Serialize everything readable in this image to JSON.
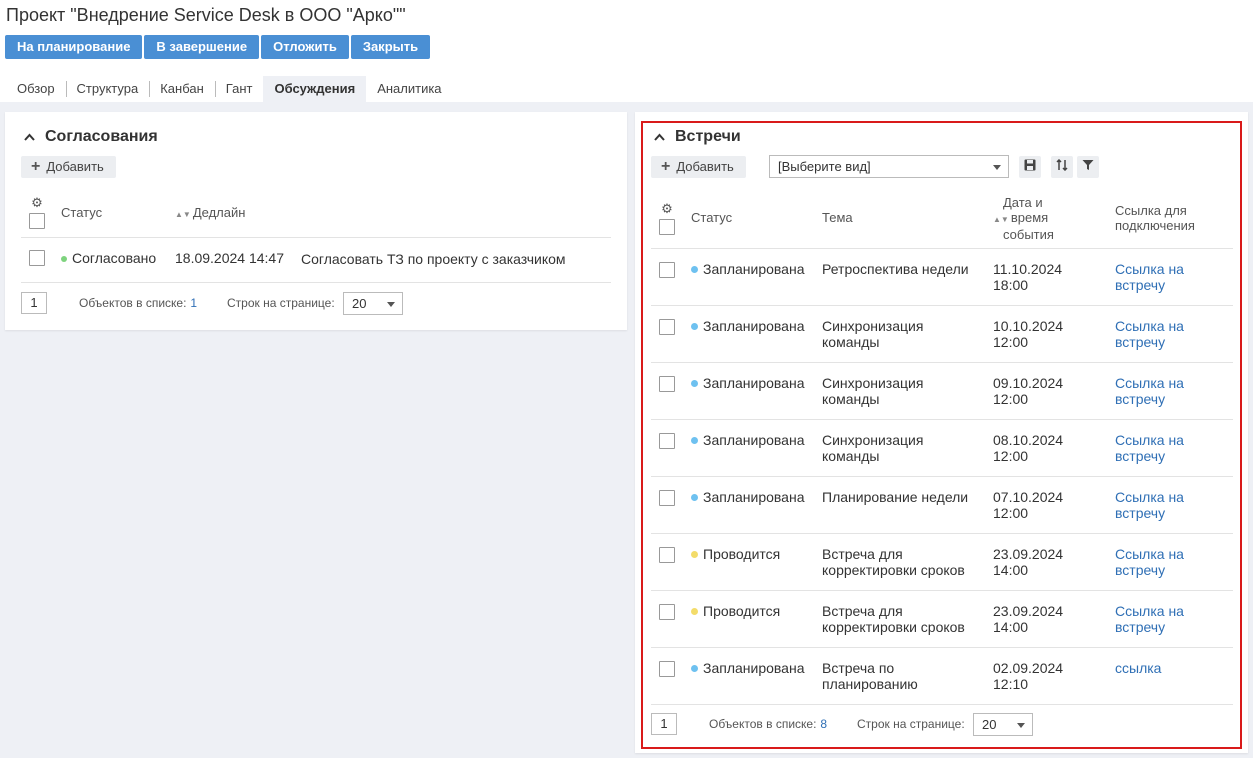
{
  "header": {
    "title": "Проект \"Внедрение Service Desk в ООО \"Арко\"\"",
    "actions": [
      "На планирование",
      "В завершение",
      "Отложить",
      "Закрыть"
    ],
    "tabs": [
      "Обзор",
      "Структура",
      "Канбан",
      "Гант",
      "Обсуждения",
      "Аналитика"
    ],
    "active_tab": "Обсуждения"
  },
  "approvals": {
    "title": "Согласования",
    "add_label": "Добавить",
    "columns": {
      "status": "Статус",
      "deadline": "Дедлайн"
    },
    "rows": [
      {
        "status": "Согласовано",
        "status_color": "#7ed37e",
        "deadline": "18.09.2024 14:47",
        "subject": "Согласовать ТЗ по проекту с заказчиком"
      }
    ],
    "footer": {
      "page": "1",
      "count_label": "Объектов в списке:",
      "count": "1",
      "per_page_label": "Строк на странице:",
      "per_page": "20"
    }
  },
  "meetings": {
    "title": "Встречи",
    "add_label": "Добавить",
    "view_select": "[Выберите вид]",
    "columns": {
      "status": "Статус",
      "topic": "Тема",
      "datetime_1": "Дата и",
      "datetime_2": "время",
      "datetime_3": "события",
      "link_1": "Ссылка для",
      "link_2": "подключения"
    },
    "rows": [
      {
        "status": "Запланирована",
        "status_color": "#6ec1f0",
        "topic_1": "Ретроспектива недели",
        "topic_2": "",
        "date": "11.10.2024",
        "time": "18:00",
        "link_1": "Ссылка на",
        "link_2": "встречу"
      },
      {
        "status": "Запланирована",
        "status_color": "#6ec1f0",
        "topic_1": "Синхронизация",
        "topic_2": "команды",
        "date": "10.10.2024",
        "time": "12:00",
        "link_1": "Ссылка на",
        "link_2": "встречу"
      },
      {
        "status": "Запланирована",
        "status_color": "#6ec1f0",
        "topic_1": "Синхронизация",
        "topic_2": "команды",
        "date": "09.10.2024",
        "time": "12:00",
        "link_1": "Ссылка на",
        "link_2": "встречу"
      },
      {
        "status": "Запланирована",
        "status_color": "#6ec1f0",
        "topic_1": "Синхронизация",
        "topic_2": "команды",
        "date": "08.10.2024",
        "time": "12:00",
        "link_1": "Ссылка на",
        "link_2": "встречу"
      },
      {
        "status": "Запланирована",
        "status_color": "#6ec1f0",
        "topic_1": "Планирование недели",
        "topic_2": "",
        "date": "07.10.2024",
        "time": "12:00",
        "link_1": "Ссылка на",
        "link_2": "встречу"
      },
      {
        "status": "Проводится",
        "status_color": "#f3dc6a",
        "topic_1": "Встреча для",
        "topic_2": "корректировки сроков",
        "date": "23.09.2024",
        "time": "14:00",
        "link_1": "Ссылка на",
        "link_2": "встречу"
      },
      {
        "status": "Проводится",
        "status_color": "#f3dc6a",
        "topic_1": "Встреча для",
        "topic_2": "корректировки сроков",
        "date": "23.09.2024",
        "time": "14:00",
        "link_1": "Ссылка на",
        "link_2": "встречу"
      },
      {
        "status": "Запланирована",
        "status_color": "#6ec1f0",
        "topic_1": "Встреча по",
        "topic_2": "планированию",
        "date": "02.09.2024",
        "time": "12:10",
        "link_1": "ссылка",
        "link_2": ""
      }
    ],
    "footer": {
      "page": "1",
      "count_label": "Объектов в списке:",
      "count": "8",
      "per_page_label": "Строк на странице:",
      "per_page": "20"
    }
  }
}
